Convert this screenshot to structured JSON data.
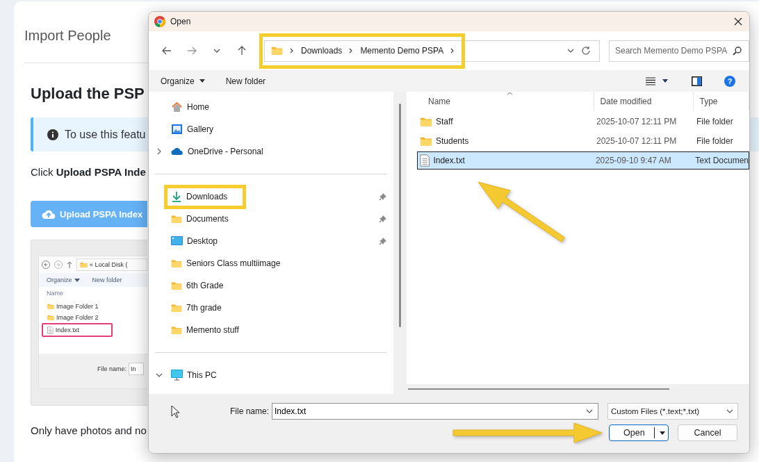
{
  "page": {
    "title": "Import People",
    "heading": "Upload the PSP",
    "notice": "To use this featu",
    "instruction": "Click **Upload PSPA Inde**",
    "upload_button": "Upload PSPA Index",
    "example_screenshot": {
      "location": "« Local Disk (",
      "toolbar": [
        {
          "label": "Organize",
          "menu": true
        },
        {
          "label": "New folder",
          "menu": false
        }
      ],
      "column": "Name",
      "items": [
        {
          "kind": "folder",
          "name": "Image Folder 1",
          "highlighted": false
        },
        {
          "kind": "folder",
          "name": "Image Folder 2",
          "highlighted": false
        },
        {
          "kind": "file",
          "name": "Index.txt",
          "highlighted": true
        }
      ],
      "file_name_label": "File name:",
      "file_name_value": "In"
    },
    "footer_text": "Only have photos and no"
  },
  "dialog": {
    "title": "Open",
    "address": {
      "segments": [
        "Downloads",
        "Memento Demo PSPA"
      ],
      "highlighted": true
    },
    "search": {
      "placeholder": "Search Memento Demo PSPA"
    },
    "toolbar": [
      {
        "label": "Organize",
        "menu": true
      },
      {
        "label": "New folder",
        "menu": false
      }
    ],
    "help": "?",
    "nav_pane": [
      [
        {
          "kind": "home",
          "label": "Home",
          "expandable": false,
          "pinned": false,
          "highlighted": false
        },
        {
          "kind": "gallery",
          "label": "Gallery",
          "expandable": false,
          "pinned": false,
          "highlighted": false
        },
        {
          "kind": "cloud",
          "label": "OneDrive - Personal",
          "expandable": true,
          "expanded": false,
          "pinned": false,
          "highlighted": false
        }
      ],
      [
        {
          "kind": "download",
          "label": "Downloads",
          "expandable": false,
          "pinned": true,
          "highlighted": true
        },
        {
          "kind": "folder",
          "label": "Documents",
          "expandable": false,
          "pinned": true,
          "highlighted": false
        },
        {
          "kind": "desktop",
          "label": "Desktop",
          "expandable": false,
          "pinned": true,
          "highlighted": false
        },
        {
          "kind": "folder",
          "label": "Seniors Class multiimage",
          "expandable": false,
          "pinned": false,
          "highlighted": false
        },
        {
          "kind": "folder",
          "label": "6th Grade",
          "expandable": false,
          "pinned": false,
          "highlighted": false
        },
        {
          "kind": "folder",
          "label": "7th grade",
          "expandable": false,
          "pinned": false,
          "highlighted": false
        },
        {
          "kind": "folder",
          "label": "Memento stuff",
          "expandable": false,
          "pinned": false,
          "highlighted": false
        }
      ],
      [
        {
          "kind": "computer",
          "label": "This PC",
          "expandable": true,
          "expanded": true,
          "pinned": false,
          "highlighted": false
        }
      ]
    ],
    "files": {
      "columns": [
        "Name",
        "Date modified",
        "Type"
      ],
      "rows": [
        {
          "kind": "folder",
          "name": "Staff",
          "date": "2025-10-07 12:11 PM",
          "type": "File folder",
          "selected": false
        },
        {
          "kind": "folder",
          "name": "Students",
          "date": "2025-10-07 12:11 PM",
          "type": "File folder",
          "selected": false
        },
        {
          "kind": "file",
          "name": "Index.txt",
          "date": "2025-09-10 9:47 AM",
          "type": "Text Documen",
          "selected": true
        }
      ]
    },
    "file_name_label": "File name:",
    "file_name": "Index.txt",
    "filter": "Custom Files (*.text;*.txt)",
    "buttons": [
      {
        "label": "Open",
        "default": true
      },
      {
        "label": "Cancel",
        "default": false
      }
    ]
  }
}
